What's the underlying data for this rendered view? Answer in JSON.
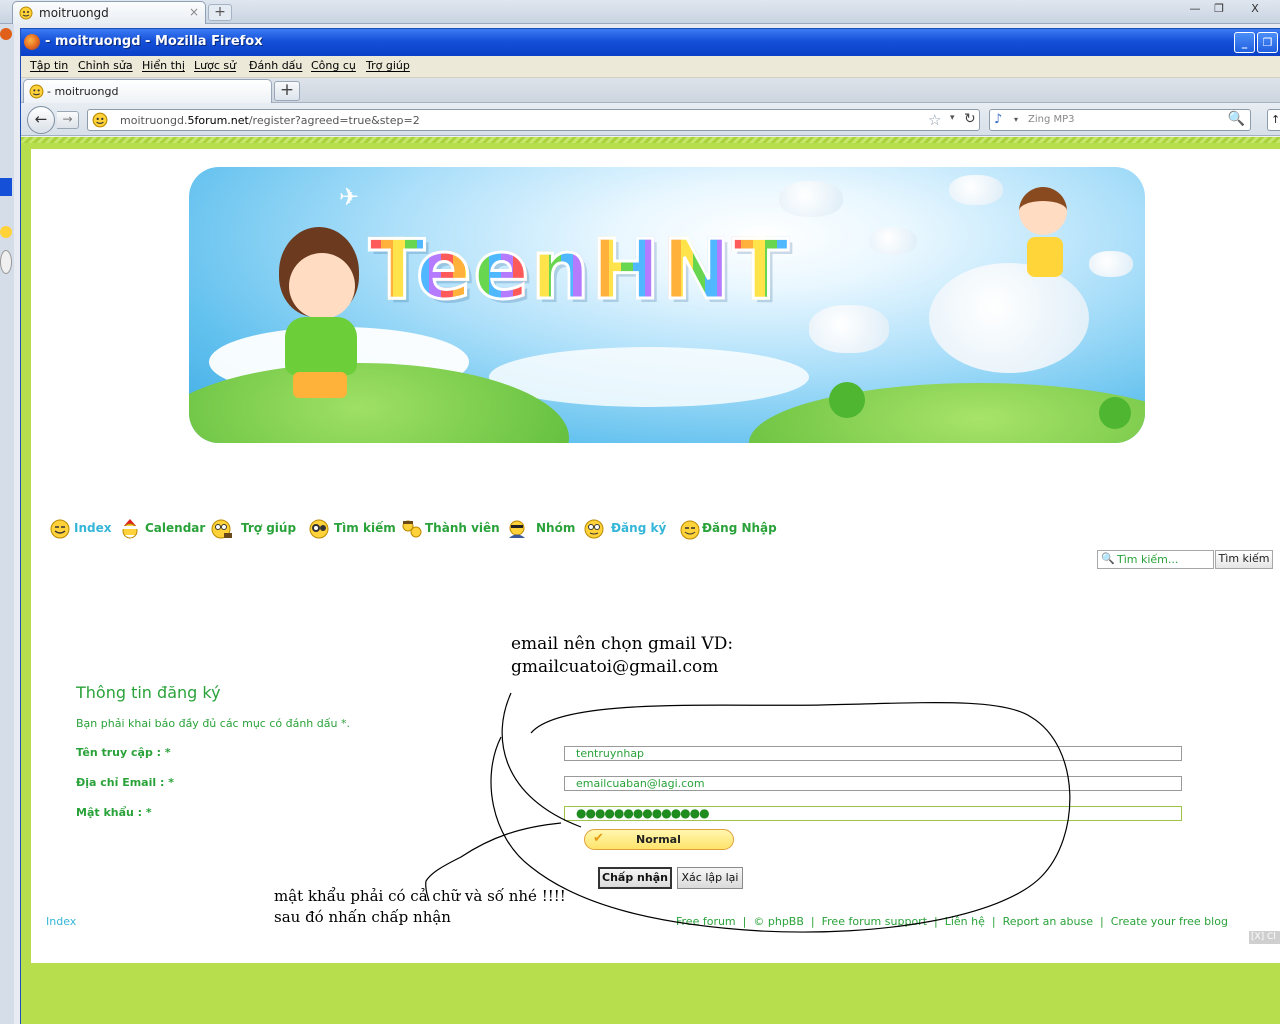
{
  "bg_window": {
    "tab_title": "moitruongd",
    "close_glyph": "×",
    "new_tab_glyph": "+",
    "minimize_glyph": "—",
    "restore_glyph": "❐",
    "close_window_glyph": "X"
  },
  "window": {
    "title": "- moitruongd - Mozilla Firefox",
    "minimize_glyph": "_",
    "restore_glyph": "❐"
  },
  "menubar": [
    "Tập tin",
    "Chỉnh sửa",
    "Hiển thị",
    "Lược sử",
    "Đánh dấu",
    "Công cụ",
    "Trợ giúp"
  ],
  "tab": {
    "title": "- moitruongd",
    "new_tab_glyph": "+"
  },
  "navbar": {
    "back_glyph": "←",
    "forward_glyph": "→",
    "url_prefix": "moitruongd.",
    "url_domain": "5forum.net",
    "url_path": "/register?agreed=true&step=2",
    "star_glyph": "☆",
    "drop_glyph": "▾",
    "reload_glyph": "↻",
    "search_engine_glyph": "♪",
    "search_placeholder": "Zing MP3",
    "magnifier_glyph": "🔍",
    "extra_glyph": "↑"
  },
  "banner": {
    "logo_text": "TeenHNT"
  },
  "forum_nav": [
    {
      "label": "Index",
      "icon": "smiley-icon",
      "style": "cyan"
    },
    {
      "label": "Calendar",
      "icon": "santa-icon",
      "style": "green"
    },
    {
      "label": "Trợ giúp",
      "icon": "help-smiley-icon",
      "style": "green"
    },
    {
      "label": "Tìm kiếm",
      "icon": "binoculars-icon",
      "style": "green"
    },
    {
      "label": "Thành viên",
      "icon": "members-icon",
      "style": "green"
    },
    {
      "label": "Nhóm",
      "icon": "group-icon",
      "style": "green"
    },
    {
      "label": "Đăng ký",
      "icon": "register-smiley-icon",
      "style": "cyan"
    },
    {
      "label": "Đăng Nhập",
      "icon": "login-smiley-icon",
      "style": "green"
    }
  ],
  "quick_search": {
    "placeholder": "Tìm kiếm...",
    "button": "Tìm kiếm",
    "magnifier_glyph": "🔍"
  },
  "registration": {
    "title": "Thông tin đăng ký",
    "note": "Bạn phải khai báo đầy đủ các mục có đánh dấu *.",
    "username_label": "Tên truy cập : *",
    "username_value": "tentruynhap",
    "email_label": "Địa chỉ Email : *",
    "email_value": "emailcuaban@lagi.com",
    "password_label": "Mật khẩu : *",
    "password_value": "●●●●●●●●●●●●●●",
    "strength": "Normal",
    "strength_glyph": "✔",
    "submit": "Chấp nhận",
    "reset": "Xác lập lại"
  },
  "annotations": {
    "email_line1": "email nên chọn gmail VD:",
    "email_line2": "gmailcuatoi@gmail.com",
    "pw_line1": "mật khẩu phải có cả chữ và số nhé !!!!",
    "pw_line2": "sau đó nhấn chấp nhận"
  },
  "footer": {
    "index": "Index",
    "links": [
      "Free forum",
      "©",
      "phpBB",
      "Free forum support",
      "Liên hệ",
      "Report an abuse",
      "Create your free blog"
    ],
    "close_ad": "[X] Cl"
  }
}
